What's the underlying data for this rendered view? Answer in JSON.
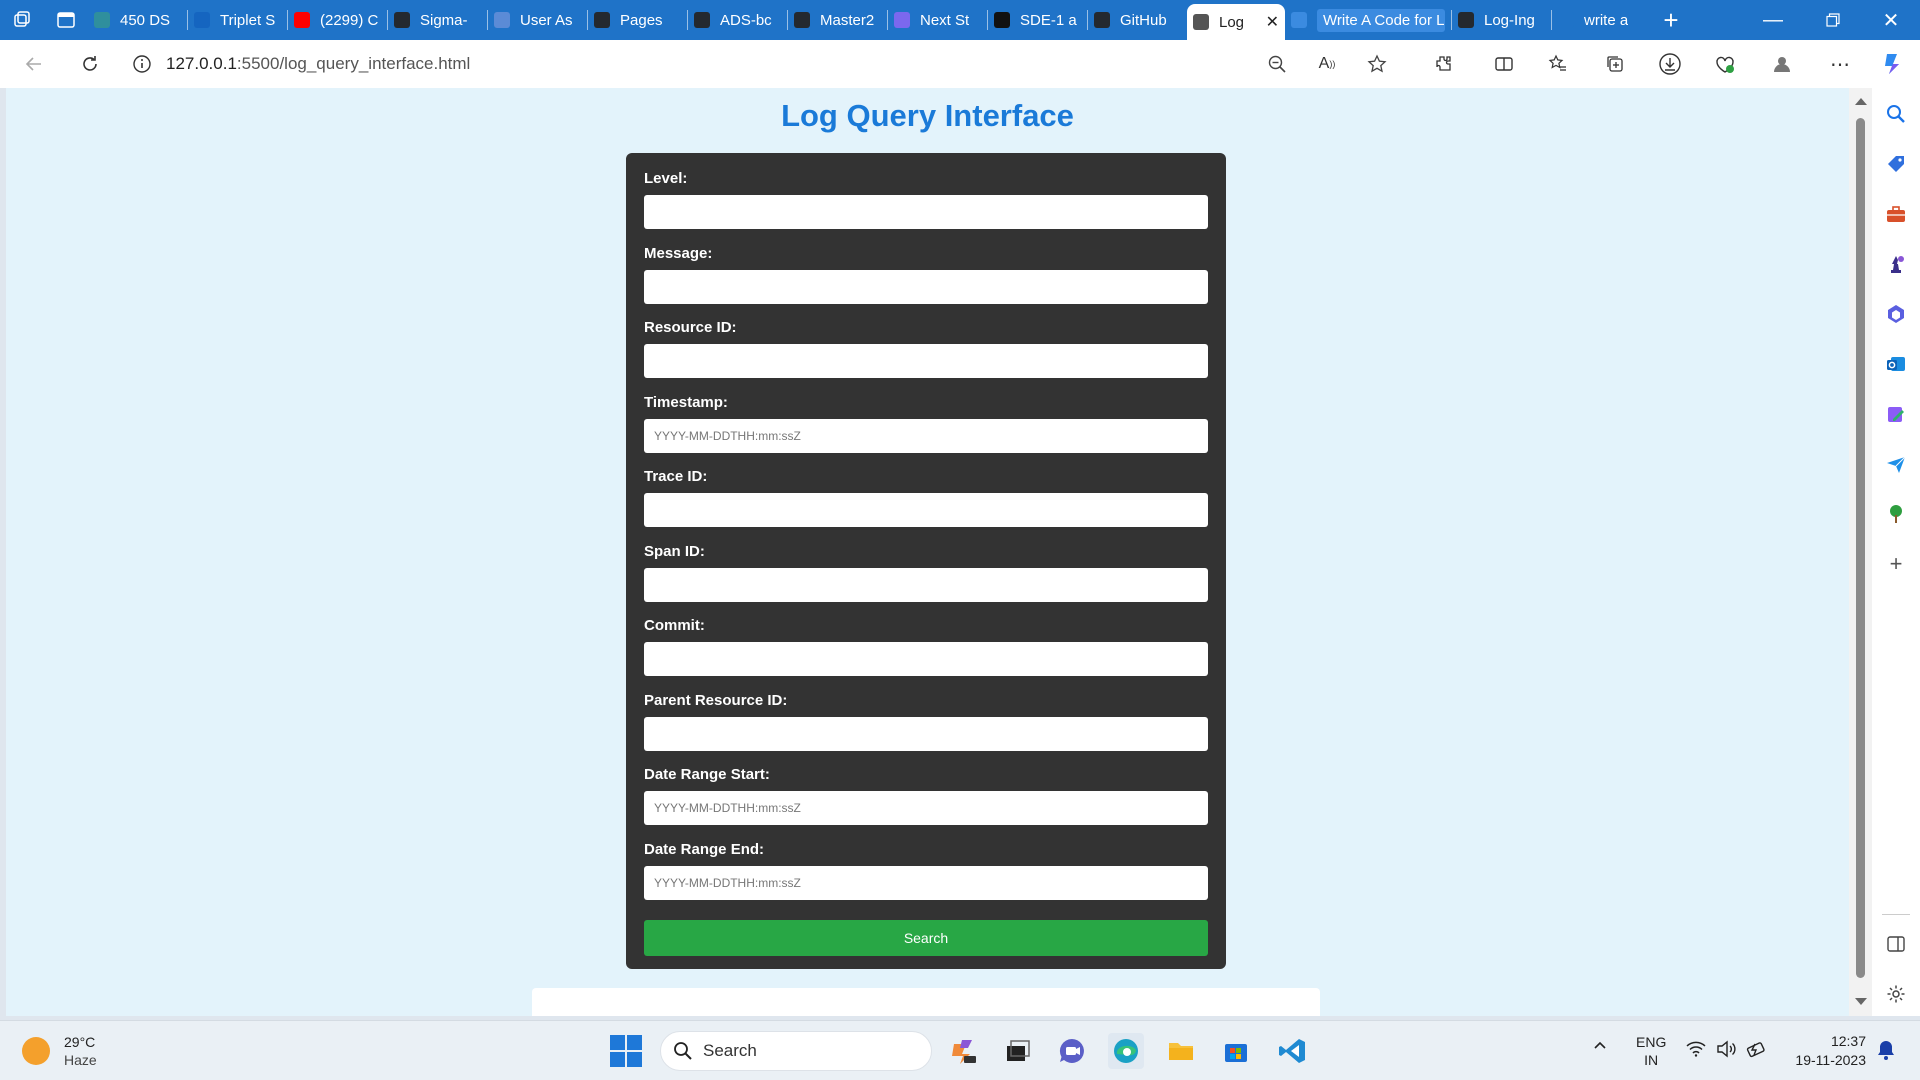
{
  "browser": {
    "tabs": [
      {
        "label": "450 DS",
        "favicon_color": "#2f8f9d"
      },
      {
        "label": "Triplet S",
        "favicon_color": "#1565c0"
      },
      {
        "label": "(2299) C",
        "favicon_color": "#ff0000"
      },
      {
        "label": "Sigma-",
        "favicon_color": "#24292f"
      },
      {
        "label": "User As",
        "favicon_color": "#5b8bd6"
      },
      {
        "label": "Pages",
        "favicon_color": "#24292f"
      },
      {
        "label": "ADS-bc",
        "favicon_color": "#24292f"
      },
      {
        "label": "Master2",
        "favicon_color": "#24292f"
      },
      {
        "label": "Next St",
        "favicon_color": "#7b68ee"
      },
      {
        "label": "SDE-1 a",
        "favicon_color": "#111111"
      },
      {
        "label": "GitHub",
        "favicon_color": "#24292f"
      },
      {
        "label": "Log",
        "favicon_color": "#555555",
        "active": true
      },
      {
        "label": "Write A Code for Log",
        "favicon_color": "#3b8be0"
      },
      {
        "label": "Log-Ing",
        "favicon_color": "#24292f"
      },
      {
        "label": "write a",
        "favicon_color": "#1f73c8"
      }
    ],
    "address": {
      "url_host": "127.0.0.1",
      "url_path": ":5500/log_query_interface.html"
    }
  },
  "page": {
    "title": "Log Query Interface",
    "fields": [
      {
        "label": "Level:",
        "value": "",
        "placeholder": ""
      },
      {
        "label": "Message:",
        "value": "",
        "placeholder": ""
      },
      {
        "label": "Resource ID:",
        "value": "",
        "placeholder": ""
      },
      {
        "label": "Timestamp:",
        "value": "",
        "placeholder": "YYYY-MM-DDTHH:mm:ssZ"
      },
      {
        "label": "Trace ID:",
        "value": "",
        "placeholder": ""
      },
      {
        "label": "Span ID:",
        "value": "",
        "placeholder": ""
      },
      {
        "label": "Commit:",
        "value": "",
        "placeholder": ""
      },
      {
        "label": "Parent Resource ID:",
        "value": "",
        "placeholder": ""
      },
      {
        "label": "Date Range Start:",
        "value": "",
        "placeholder": "YYYY-MM-DDTHH:mm:ssZ"
      },
      {
        "label": "Date Range End:",
        "value": "",
        "placeholder": "YYYY-MM-DDTHH:mm:ssZ"
      }
    ],
    "search_button": "Search"
  },
  "taskbar": {
    "weather": {
      "temp": "29°C",
      "condition": "Haze"
    },
    "search_label": "Search",
    "language": {
      "line1": "ENG",
      "line2": "IN"
    },
    "time": "12:37",
    "date": "19-11-2023"
  },
  "colors": {
    "tabbar": "#1f73c8",
    "page_background": "#e3f3fb",
    "title": "#1a7ad8",
    "card": "#333333",
    "search_button": "#28a745"
  }
}
